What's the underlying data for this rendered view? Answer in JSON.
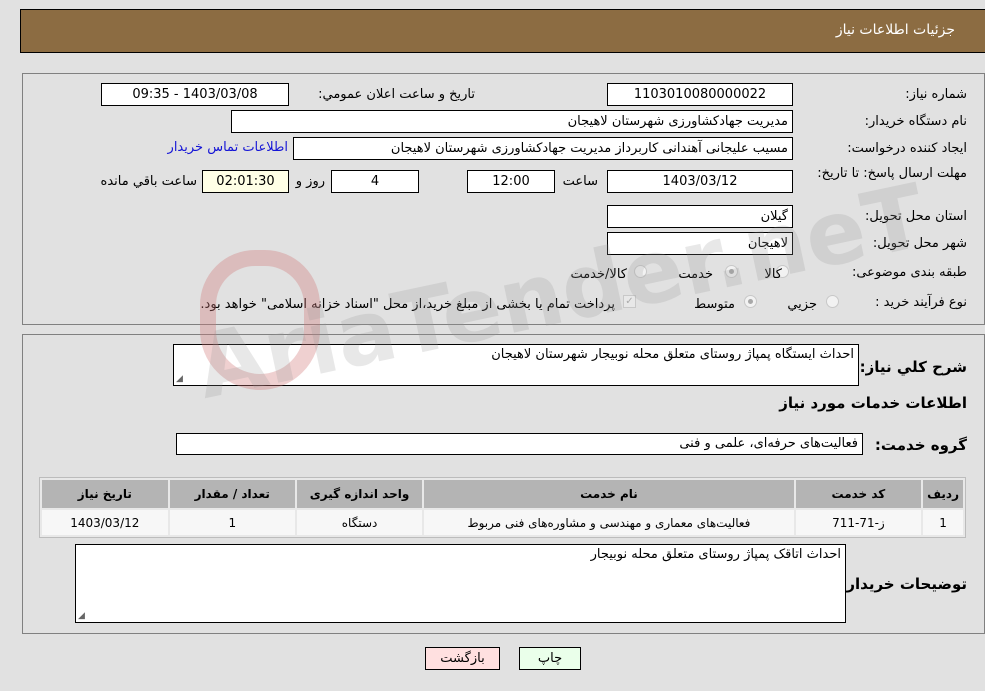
{
  "header": {
    "title": "جزئیات اطلاعات نیاز"
  },
  "fields": {
    "need_number_label": "شماره نیاز:",
    "need_number": "1103010080000022",
    "announce_label": "تاریخ و ساعت اعلان عمومي:",
    "announce_value": "1403/03/08 - 09:35",
    "buyer_org_label": "نام دستگاه خریدار:",
    "buyer_org": "مدیریت جهادکشاورزی شهرستان لاهیجان",
    "creator_label": "ایجاد کننده درخواست:",
    "creator": "مسیب علیجانی آهندانی کاربرداز مدیریت جهادکشاورزی شهرستان لاهیجان",
    "contact_link": "اطلاعات تماس خریدار",
    "deadline_label": "مهلت ارسال پاسخ: تا تاریخ:",
    "deadline_date": "1403/03/12",
    "time_label": "ساعت",
    "deadline_time": "12:00",
    "days_value": "4",
    "days_label": "روز و",
    "remaining_time": "02:01:30",
    "remaining_label": "ساعت باقي مانده",
    "province_label": "استان محل تحویل:",
    "province": "گیلان",
    "city_label": "شهر محل تحویل:",
    "city": "لاهیجان",
    "category_label": "طبقه بندی موضوعی:",
    "category_options": [
      {
        "label": "کالا",
        "selected": false
      },
      {
        "label": "خدمت",
        "selected": true
      },
      {
        "label": "کالا/خدمت",
        "selected": false
      }
    ],
    "process_label": "نوع فرآیند خرید :",
    "process_options": [
      {
        "label": "جزيي",
        "selected": false
      },
      {
        "label": "متوسط",
        "selected": true
      }
    ],
    "treasury_note": "پرداخت تمام یا بخشی از مبلغ خرید،از محل \"اسناد خزانه اسلامی\" خواهد بود.",
    "treasury_checked": true
  },
  "details": {
    "description_label": "شرح كلي نياز:",
    "description": "احداث ایستگاه پمپاژ روستای متعلق محله نوبیجار شهرستان لاهیجان",
    "services_heading": "اطلاعات خدمات مورد نیاز",
    "service_group_label": "گروه خدمت:",
    "service_group": "فعالیت‌های حرفه‌ای، علمی و فنی",
    "table": {
      "headers": [
        "ردیف",
        "کد خدمت",
        "نام خدمت",
        "واحد اندازه گیری",
        "تعداد / مقدار",
        "تاریخ نیاز"
      ],
      "rows": [
        [
          "1",
          "ز-71-711",
          "فعالیت‌های معماری و مهندسی و مشاوره‌های فنی مربوط",
          "دستگاه",
          "1",
          "1403/03/12"
        ]
      ]
    },
    "buyer_notes_label": "توضیحات خریدار:",
    "buyer_notes": "احداث اتاقک پمپاژ روستای متعلق محله نوبیجار"
  },
  "buttons": {
    "print": "چاپ",
    "back": "بازگشت"
  },
  "watermark": "AriaTender.neT"
}
